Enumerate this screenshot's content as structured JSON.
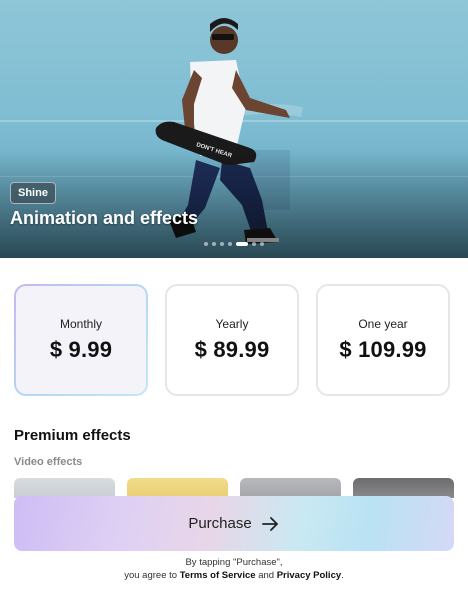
{
  "hero": {
    "badge": "Shine",
    "title": "Animation and effects",
    "pagination": {
      "count": 8,
      "active_index": 4
    },
    "skateboard_text": "DON'T HEAR"
  },
  "plans": [
    {
      "name": "Monthly",
      "price": "$ 9.99",
      "selected": true
    },
    {
      "name": "Yearly",
      "price": "$ 89.99",
      "selected": false
    },
    {
      "name": "One year",
      "price": "$ 109.99",
      "selected": false
    }
  ],
  "premium": {
    "title": "Premium effects",
    "subtitle": "Video effects"
  },
  "purchase": {
    "label": "Purchase",
    "icon": "arrow-right-icon"
  },
  "legal": {
    "line1": "By tapping \"Purchase\",",
    "prefix": "you agree to ",
    "terms": "Terms of Service",
    "and": " and ",
    "privacy": "Privacy Policy",
    "suffix": "."
  },
  "colors": {
    "selected_border": "#c8b6f0",
    "card_border": "#e6e6e9",
    "muted_text": "#8a8a8f"
  }
}
